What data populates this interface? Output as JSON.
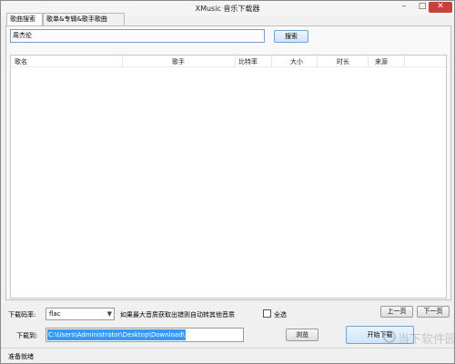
{
  "window": {
    "title": "XMusic 音乐下载器",
    "min": "–",
    "max": "□",
    "close": "✕"
  },
  "tabs": [
    {
      "label": "歌曲搜索",
      "active": true
    },
    {
      "label": "歌单&专辑&歌手歌曲",
      "active": false
    }
  ],
  "search": {
    "value": "周杰伦",
    "button": "搜索"
  },
  "list": {
    "columns": [
      "歌名",
      "歌手",
      "比特率",
      "大小",
      "时长",
      "来源"
    ]
  },
  "controls": {
    "bitrate_label": "下载码率:",
    "bitrate_value": "flac",
    "hint": "如果最大音质获取出错则自动转其他音质",
    "select_all": "全选",
    "prev": "上一页",
    "next": "下一页",
    "download_to_label": "下载到:",
    "download_path": "C:\\Users\\Administrator\\Desktop\\Download\\",
    "browse": "浏览",
    "start_download": "开始下载"
  },
  "status": {
    "text": "准备就绪"
  },
  "watermark": {
    "text": "当下软件园"
  },
  "colors": {
    "selection": "#3399ff",
    "close": "#c9413c",
    "accent_border": "#6fa3d6"
  }
}
